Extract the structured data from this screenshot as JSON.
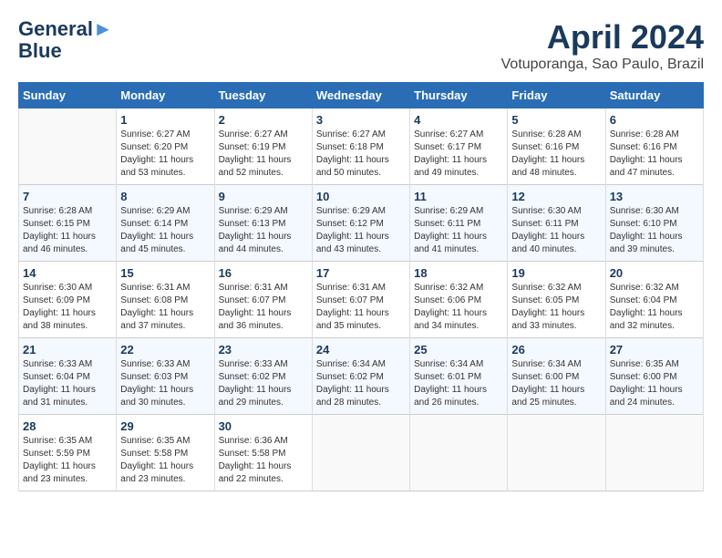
{
  "header": {
    "logo_line1": "General",
    "logo_line2": "Blue",
    "month_title": "April 2024",
    "location": "Votuporanga, Sao Paulo, Brazil"
  },
  "days_of_week": [
    "Sunday",
    "Monday",
    "Tuesday",
    "Wednesday",
    "Thursday",
    "Friday",
    "Saturday"
  ],
  "weeks": [
    [
      {
        "day": "",
        "sunrise": "",
        "sunset": "",
        "daylight": ""
      },
      {
        "day": "1",
        "sunrise": "Sunrise: 6:27 AM",
        "sunset": "Sunset: 6:20 PM",
        "daylight": "Daylight: 11 hours and 53 minutes."
      },
      {
        "day": "2",
        "sunrise": "Sunrise: 6:27 AM",
        "sunset": "Sunset: 6:19 PM",
        "daylight": "Daylight: 11 hours and 52 minutes."
      },
      {
        "day": "3",
        "sunrise": "Sunrise: 6:27 AM",
        "sunset": "Sunset: 6:18 PM",
        "daylight": "Daylight: 11 hours and 50 minutes."
      },
      {
        "day": "4",
        "sunrise": "Sunrise: 6:27 AM",
        "sunset": "Sunset: 6:17 PM",
        "daylight": "Daylight: 11 hours and 49 minutes."
      },
      {
        "day": "5",
        "sunrise": "Sunrise: 6:28 AM",
        "sunset": "Sunset: 6:16 PM",
        "daylight": "Daylight: 11 hours and 48 minutes."
      },
      {
        "day": "6",
        "sunrise": "Sunrise: 6:28 AM",
        "sunset": "Sunset: 6:16 PM",
        "daylight": "Daylight: 11 hours and 47 minutes."
      }
    ],
    [
      {
        "day": "7",
        "sunrise": "Sunrise: 6:28 AM",
        "sunset": "Sunset: 6:15 PM",
        "daylight": "Daylight: 11 hours and 46 minutes."
      },
      {
        "day": "8",
        "sunrise": "Sunrise: 6:29 AM",
        "sunset": "Sunset: 6:14 PM",
        "daylight": "Daylight: 11 hours and 45 minutes."
      },
      {
        "day": "9",
        "sunrise": "Sunrise: 6:29 AM",
        "sunset": "Sunset: 6:13 PM",
        "daylight": "Daylight: 11 hours and 44 minutes."
      },
      {
        "day": "10",
        "sunrise": "Sunrise: 6:29 AM",
        "sunset": "Sunset: 6:12 PM",
        "daylight": "Daylight: 11 hours and 43 minutes."
      },
      {
        "day": "11",
        "sunrise": "Sunrise: 6:29 AM",
        "sunset": "Sunset: 6:11 PM",
        "daylight": "Daylight: 11 hours and 41 minutes."
      },
      {
        "day": "12",
        "sunrise": "Sunrise: 6:30 AM",
        "sunset": "Sunset: 6:11 PM",
        "daylight": "Daylight: 11 hours and 40 minutes."
      },
      {
        "day": "13",
        "sunrise": "Sunrise: 6:30 AM",
        "sunset": "Sunset: 6:10 PM",
        "daylight": "Daylight: 11 hours and 39 minutes."
      }
    ],
    [
      {
        "day": "14",
        "sunrise": "Sunrise: 6:30 AM",
        "sunset": "Sunset: 6:09 PM",
        "daylight": "Daylight: 11 hours and 38 minutes."
      },
      {
        "day": "15",
        "sunrise": "Sunrise: 6:31 AM",
        "sunset": "Sunset: 6:08 PM",
        "daylight": "Daylight: 11 hours and 37 minutes."
      },
      {
        "day": "16",
        "sunrise": "Sunrise: 6:31 AM",
        "sunset": "Sunset: 6:07 PM",
        "daylight": "Daylight: 11 hours and 36 minutes."
      },
      {
        "day": "17",
        "sunrise": "Sunrise: 6:31 AM",
        "sunset": "Sunset: 6:07 PM",
        "daylight": "Daylight: 11 hours and 35 minutes."
      },
      {
        "day": "18",
        "sunrise": "Sunrise: 6:32 AM",
        "sunset": "Sunset: 6:06 PM",
        "daylight": "Daylight: 11 hours and 34 minutes."
      },
      {
        "day": "19",
        "sunrise": "Sunrise: 6:32 AM",
        "sunset": "Sunset: 6:05 PM",
        "daylight": "Daylight: 11 hours and 33 minutes."
      },
      {
        "day": "20",
        "sunrise": "Sunrise: 6:32 AM",
        "sunset": "Sunset: 6:04 PM",
        "daylight": "Daylight: 11 hours and 32 minutes."
      }
    ],
    [
      {
        "day": "21",
        "sunrise": "Sunrise: 6:33 AM",
        "sunset": "Sunset: 6:04 PM",
        "daylight": "Daylight: 11 hours and 31 minutes."
      },
      {
        "day": "22",
        "sunrise": "Sunrise: 6:33 AM",
        "sunset": "Sunset: 6:03 PM",
        "daylight": "Daylight: 11 hours and 30 minutes."
      },
      {
        "day": "23",
        "sunrise": "Sunrise: 6:33 AM",
        "sunset": "Sunset: 6:02 PM",
        "daylight": "Daylight: 11 hours and 29 minutes."
      },
      {
        "day": "24",
        "sunrise": "Sunrise: 6:34 AM",
        "sunset": "Sunset: 6:02 PM",
        "daylight": "Daylight: 11 hours and 28 minutes."
      },
      {
        "day": "25",
        "sunrise": "Sunrise: 6:34 AM",
        "sunset": "Sunset: 6:01 PM",
        "daylight": "Daylight: 11 hours and 26 minutes."
      },
      {
        "day": "26",
        "sunrise": "Sunrise: 6:34 AM",
        "sunset": "Sunset: 6:00 PM",
        "daylight": "Daylight: 11 hours and 25 minutes."
      },
      {
        "day": "27",
        "sunrise": "Sunrise: 6:35 AM",
        "sunset": "Sunset: 6:00 PM",
        "daylight": "Daylight: 11 hours and 24 minutes."
      }
    ],
    [
      {
        "day": "28",
        "sunrise": "Sunrise: 6:35 AM",
        "sunset": "Sunset: 5:59 PM",
        "daylight": "Daylight: 11 hours and 23 minutes."
      },
      {
        "day": "29",
        "sunrise": "Sunrise: 6:35 AM",
        "sunset": "Sunset: 5:58 PM",
        "daylight": "Daylight: 11 hours and 23 minutes."
      },
      {
        "day": "30",
        "sunrise": "Sunrise: 6:36 AM",
        "sunset": "Sunset: 5:58 PM",
        "daylight": "Daylight: 11 hours and 22 minutes."
      },
      {
        "day": "",
        "sunrise": "",
        "sunset": "",
        "daylight": ""
      },
      {
        "day": "",
        "sunrise": "",
        "sunset": "",
        "daylight": ""
      },
      {
        "day": "",
        "sunrise": "",
        "sunset": "",
        "daylight": ""
      },
      {
        "day": "",
        "sunrise": "",
        "sunset": "",
        "daylight": ""
      }
    ]
  ]
}
